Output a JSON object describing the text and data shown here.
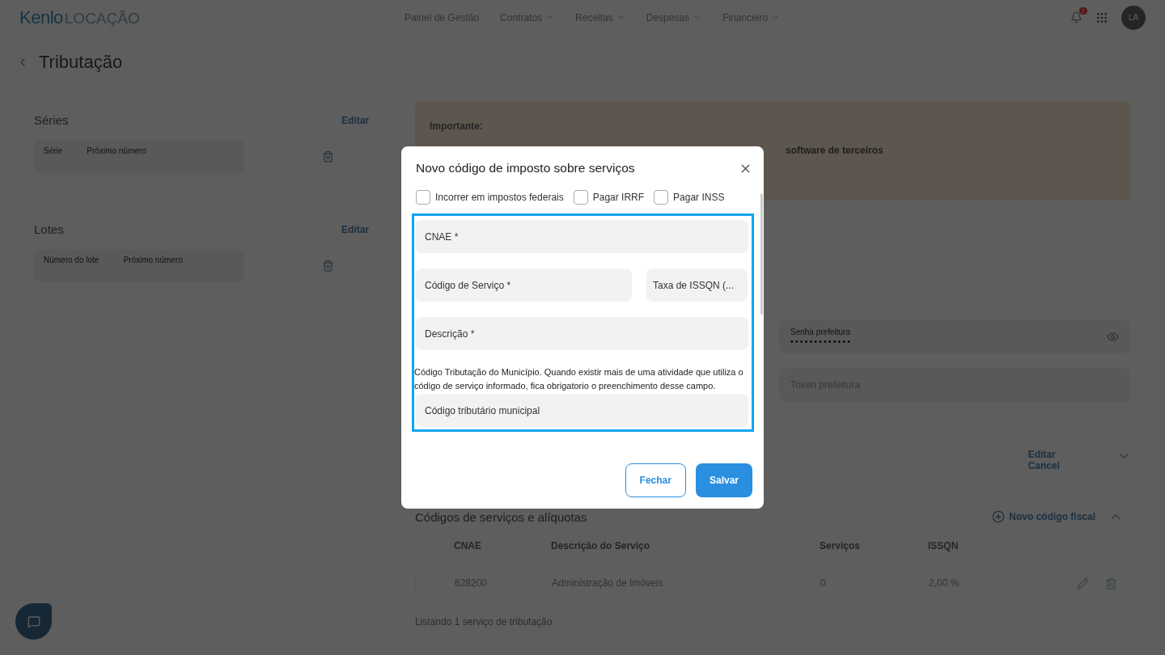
{
  "header": {
    "logo": {
      "brand": "Kenlo",
      "product": "LOCAÇÃO"
    },
    "nav": [
      {
        "label": "Painel de Gestão",
        "dropdown": false
      },
      {
        "label": "Contratos",
        "dropdown": true
      },
      {
        "label": "Receitas",
        "dropdown": true
      },
      {
        "label": "Despesas",
        "dropdown": true
      },
      {
        "label": "Financeiro",
        "dropdown": true
      }
    ],
    "notifications": "2",
    "avatar": "LA"
  },
  "page": {
    "title": "Tributação"
  },
  "sidebar": [
    {
      "title": "Séries",
      "action": "Editar",
      "fields": [
        "Série",
        "Próximo número"
      ]
    },
    {
      "title": "Lotes",
      "action": "Editar",
      "fields": [
        "Número do lote",
        "Próximo número"
      ]
    }
  ],
  "notice": {
    "title": "Importante:",
    "text": "software de terceiros"
  },
  "credentials": [
    {
      "kind": "password",
      "label": "Senha prefeitura",
      "value": "•••••••••••••"
    },
    {
      "kind": "text",
      "placeholder": "Token prefeitura"
    }
  ],
  "section_actions": [
    "Editar",
    "Cancel"
  ],
  "services": {
    "title": "Códigos de serviços e alíquotas",
    "action": "Novo código fiscal",
    "expanded": true,
    "columns": [
      "CNAE",
      "Descrição do Serviço",
      "Serviços",
      "ISSQN"
    ],
    "rows": [
      [
        "628200",
        "Administração de Imóveis",
        "0",
        "2,00 %"
      ]
    ],
    "footer": "Listando 1 serviço de tributação"
  },
  "modal": {
    "title": "Novo código de imposto sobre serviços",
    "checkboxes": [
      {
        "label": "Incorrer em impostos federais",
        "checked": false
      },
      {
        "label": "Pagar IRRF",
        "checked": false
      },
      {
        "label": "Pagar INSS",
        "checked": false
      }
    ],
    "fields": [
      {
        "kind": "full",
        "placeholder": "CNAE *"
      },
      {
        "kind": "pair",
        "items": [
          {
            "placeholder": "Código de Serviço *"
          },
          {
            "placeholder": "Taxa de ISSQN (..."
          }
        ]
      },
      {
        "kind": "full",
        "placeholder": "Descrição *"
      },
      {
        "kind": "help",
        "text": "Código Tributação do Município. Quando existir mais de uma atividade que utiliza o código de serviço informado, fica obrigatorio o preenchimento desse campo."
      },
      {
        "kind": "full",
        "placeholder": "Código tributário municipal"
      }
    ],
    "buttons": [
      {
        "label": "Fechar",
        "kind": "secondary"
      },
      {
        "label": "Salvar",
        "kind": "primary"
      }
    ]
  }
}
